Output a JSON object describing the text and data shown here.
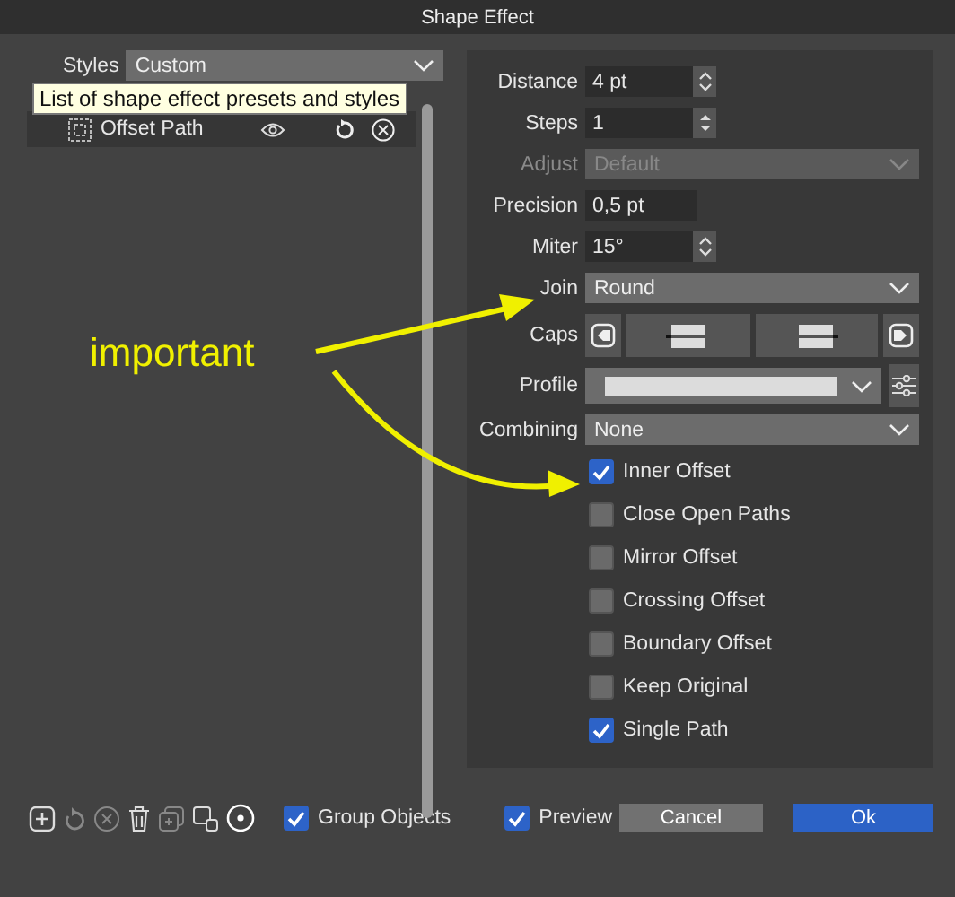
{
  "window": {
    "title": "Shape Effect"
  },
  "styles": {
    "label": "Styles",
    "value": "Custom",
    "tooltip": "List of shape effect presets and styles"
  },
  "effects": [
    {
      "name": "Offset Path",
      "selected": true
    }
  ],
  "fields": [
    {
      "kind": "spin",
      "label": "Distance",
      "value": "4 pt"
    },
    {
      "kind": "stepper",
      "label": "Steps",
      "value": "1"
    },
    {
      "kind": "dropdown",
      "label": "Adjust",
      "value": "Default",
      "disabled": true
    },
    {
      "kind": "text",
      "label": "Precision",
      "value": "0,5 pt"
    },
    {
      "kind": "spin",
      "label": "Miter",
      "value": "15°"
    },
    {
      "kind": "dropdown",
      "label": "Join",
      "value": "Round",
      "disabled": false
    },
    {
      "kind": "caps",
      "label": "Caps"
    },
    {
      "kind": "profile",
      "label": "Profile"
    },
    {
      "kind": "dropdown",
      "label": "Combining",
      "value": "None",
      "disabled": false
    }
  ],
  "options": [
    {
      "label": "Inner Offset",
      "checked": true
    },
    {
      "label": "Close Open Paths",
      "checked": false
    },
    {
      "label": "Mirror Offset",
      "checked": false
    },
    {
      "label": "Crossing Offset",
      "checked": false
    },
    {
      "label": "Boundary Offset",
      "checked": false
    },
    {
      "label": "Keep Original",
      "checked": false
    },
    {
      "label": "Single Path",
      "checked": true
    }
  ],
  "footer": {
    "checks": [
      {
        "label": "Group Objects",
        "checked": true
      },
      {
        "label": "Preview",
        "checked": true
      }
    ],
    "buttons": [
      {
        "label": "Cancel",
        "kind": "secondary"
      },
      {
        "label": "Ok",
        "kind": "primary"
      }
    ]
  },
  "annotation": {
    "text": "important"
  }
}
